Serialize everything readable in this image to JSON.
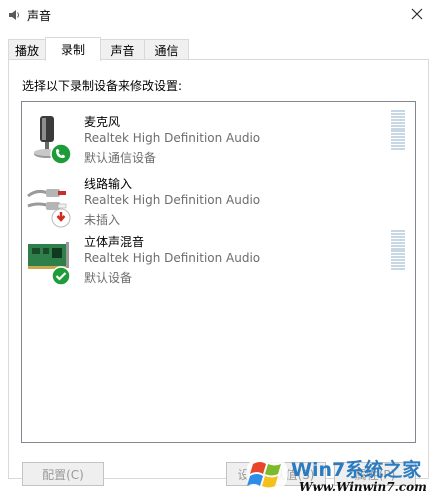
{
  "window": {
    "title": "声音",
    "icon": "speaker-icon",
    "close_icon": "close-icon"
  },
  "tabs": [
    {
      "label": "播放",
      "active": false
    },
    {
      "label": "录制",
      "active": true
    },
    {
      "label": "声音",
      "active": false
    },
    {
      "label": "通信",
      "active": false
    }
  ],
  "instruction": "选择以下录制设备来修改设置:",
  "devices": [
    {
      "name": "麦克风",
      "driver": "Realtek High Definition Audio",
      "status": "默认通信设备",
      "icon": "microphone-icon",
      "badge": "phone-badge-icon",
      "badge_color": "#1e9c3a",
      "has_level_meter": true
    },
    {
      "name": "线路输入",
      "driver": "Realtek High Definition Audio",
      "status": "未插入",
      "icon": "line-in-cable-icon",
      "badge": "unplugged-arrow-icon",
      "badge_color": "#d42a20",
      "has_level_meter": false
    },
    {
      "name": "立体声混音",
      "driver": "Realtek High Definition Audio",
      "status": "默认设备",
      "icon": "sound-card-icon",
      "badge": "check-badge-icon",
      "badge_color": "#1e9c3a",
      "has_level_meter": true
    }
  ],
  "buttons": {
    "configure": "配置(C)",
    "set_default": "设为默认值(S)",
    "properties": "属性(P)"
  },
  "watermark": {
    "brand": "Win7系统之家",
    "url": "Www.Winwin7.com"
  },
  "colors": {
    "accent_green": "#1e9c3a",
    "accent_red": "#d42a20",
    "level_meter": "#c7d7e3",
    "disabled_text": "#9a9a9a"
  }
}
